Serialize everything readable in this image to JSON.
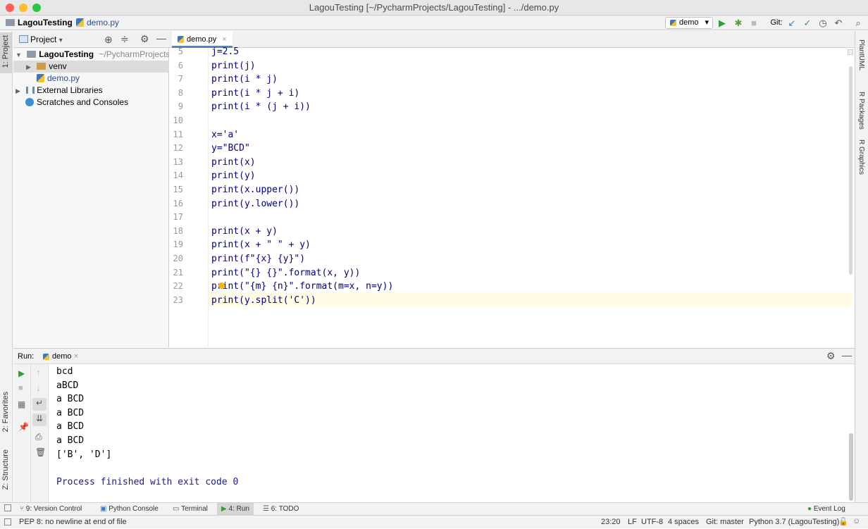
{
  "window": {
    "title": "LagouTesting [~/PycharmProjects/LagouTesting] - .../demo.py"
  },
  "breadcrumb": {
    "project": "LagouTesting",
    "file": "demo.py"
  },
  "toolbar": {
    "run_config": "demo",
    "git_label": "Git:"
  },
  "left_strip": {
    "project_tab": "1: Project",
    "favorites_tab": "2: Favorites",
    "structure_tab": "Z: Structure"
  },
  "right_strip": {
    "plantuml": "PlantUML",
    "rpackages": "R Packages",
    "rgraphics": "R Graphics"
  },
  "project_panel": {
    "header": "Project",
    "tree": [
      {
        "label": "LagouTesting",
        "suffix": "~/PycharmProjects/L"
      },
      {
        "label": "venv"
      },
      {
        "label": "demo.py"
      },
      {
        "label": "External Libraries"
      },
      {
        "label": "Scratches and Consoles"
      }
    ]
  },
  "editor": {
    "tab": "demo.py",
    "lines": [
      {
        "num": "5",
        "code": "j=2.5"
      },
      {
        "num": "6",
        "code": "print(j)"
      },
      {
        "num": "7",
        "code": "print(i * j)"
      },
      {
        "num": "8",
        "code": "print(i * j + i)"
      },
      {
        "num": "9",
        "code": "print(i * (j + i))"
      },
      {
        "num": "10",
        "code": ""
      },
      {
        "num": "11",
        "code": "x='a'"
      },
      {
        "num": "12",
        "code": "y=\"BCD\""
      },
      {
        "num": "13",
        "code": "print(x)"
      },
      {
        "num": "14",
        "code": "print(y)"
      },
      {
        "num": "15",
        "code": "print(x.upper())"
      },
      {
        "num": "16",
        "code": "print(y.lower())"
      },
      {
        "num": "17",
        "code": ""
      },
      {
        "num": "18",
        "code": "print(x + y)"
      },
      {
        "num": "19",
        "code": "print(x + \" \" + y)"
      },
      {
        "num": "20",
        "code": "print(f\"{x} {y}\")"
      },
      {
        "num": "21",
        "code": "print(\"{} {}\".format(x, y))"
      },
      {
        "num": "22",
        "code": "print(\"{m} {n}\".format(m=x, n=y))"
      },
      {
        "num": "23",
        "code": "print(y.split('C'))"
      }
    ]
  },
  "run_panel": {
    "label": "Run:",
    "tab": "demo",
    "output": [
      "bcd",
      "aBCD",
      "a BCD",
      "a BCD",
      "a BCD",
      "a BCD",
      "['B', 'D']",
      "",
      "Process finished with exit code 0"
    ]
  },
  "bottom_tabs": [
    {
      "label": "9: Version Control"
    },
    {
      "label": "Python Console"
    },
    {
      "label": "Terminal"
    },
    {
      "label": "4: Run"
    },
    {
      "label": "6: TODO"
    }
  ],
  "event_log": "Event Log",
  "status": {
    "message": "PEP 8: no newline at end of file",
    "position": "23:20",
    "line_sep": "LF",
    "encoding": "UTF-8",
    "indent": "4 spaces",
    "git": "Git: master",
    "interpreter": "Python 3.7 (LagouTesting)"
  },
  "colors": {
    "accent": "#4a88c7",
    "string": "#067d17",
    "keyword": "#000080",
    "current_line": "#fffae3"
  }
}
